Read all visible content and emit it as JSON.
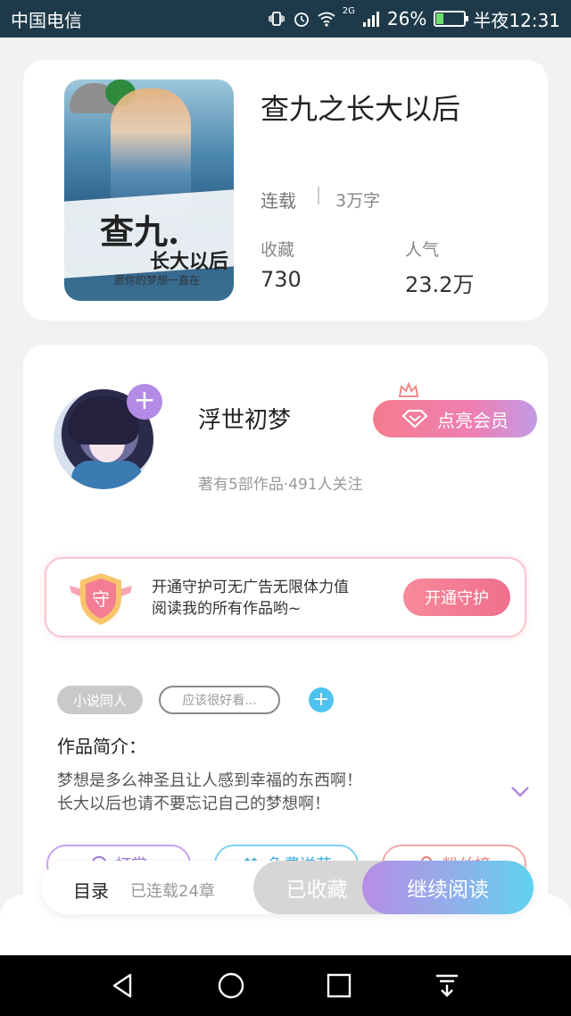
{
  "status_bar": {
    "carrier": "中国电信",
    "battery": "26%",
    "time": "半夜12:31",
    "network": "2G",
    "battery_level": 0.26
  },
  "book": {
    "title": "查九之长大以后",
    "status": "连载",
    "word_count": "3万字",
    "favorites_label": "收藏",
    "favorites_value": "730",
    "popularity_label": "人气",
    "popularity_value": "23.2万",
    "cover": {
      "title_main": "查九.",
      "title_sub": "长大以后",
      "slogan": "愿你的梦想一直在"
    }
  },
  "author": {
    "name": "浮世初梦",
    "meta": "著有5部作品·491人关注",
    "vip_button": "点亮会员"
  },
  "guard": {
    "badge": "守",
    "text_line1": "开通守护可无广告无限体力值",
    "text_line2": "阅读我的所有作品哟~",
    "button": "开通守护"
  },
  "tags": {
    "tag1": "小说同人",
    "input_placeholder": "应该很好看..."
  },
  "intro": {
    "title": "作品简介：",
    "line1": "梦想是多么神圣且让人感到幸福的东西啊！",
    "line2": "长大以后也请不要忘记自己的梦想啊！"
  },
  "actions": {
    "reward": "打赏",
    "free_recommend": "免费送花",
    "fans": "粉丝榜"
  },
  "read_bar": {
    "toc_label": "目录",
    "chapters": "已连载24章",
    "collected_label": "已收藏",
    "continue_label": "继续阅读"
  }
}
